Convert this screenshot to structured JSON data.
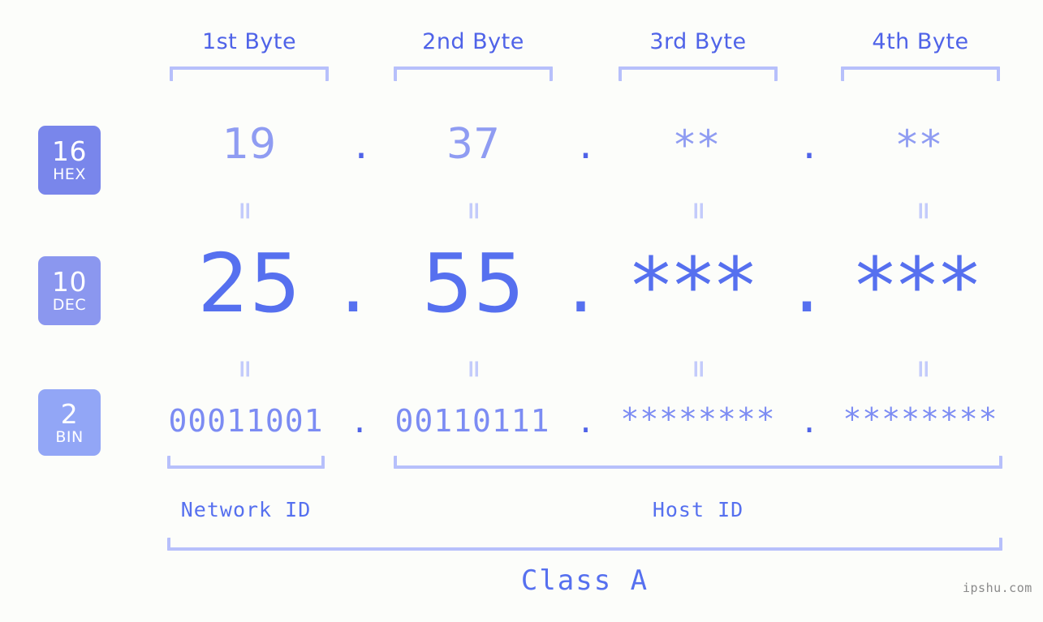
{
  "background_color": "#fcfdfa",
  "accent_color": "#5670ef",
  "light_accent_color": "#b7c0fb",
  "header": {
    "bytes": [
      {
        "label": "1st Byte"
      },
      {
        "label": "2nd Byte"
      },
      {
        "label": "3rd Byte"
      },
      {
        "label": "4th Byte"
      }
    ]
  },
  "rows": [
    {
      "badge_number": "16",
      "badge_name": "HEX",
      "badge_color": "#7986eb",
      "values": [
        "19",
        "37",
        "**",
        "**"
      ],
      "separators": [
        ".",
        ".",
        "."
      ]
    },
    {
      "badge_number": "10",
      "badge_name": "DEC",
      "badge_color": "#8b97ef",
      "values": [
        "25",
        "55",
        "***",
        "***"
      ],
      "separators": [
        ".",
        ".",
        "."
      ]
    },
    {
      "badge_number": "2",
      "badge_name": "BIN",
      "badge_color": "#92a6f6",
      "values": [
        "00011001",
        "00110111",
        "********",
        "********"
      ],
      "separators": [
        ".",
        ".",
        "."
      ]
    }
  ],
  "equals_glyph": "=",
  "footer": {
    "network_id_label": "Network ID",
    "host_id_label": "Host ID",
    "class_label": "Class A",
    "watermark": "ipshu.com"
  }
}
